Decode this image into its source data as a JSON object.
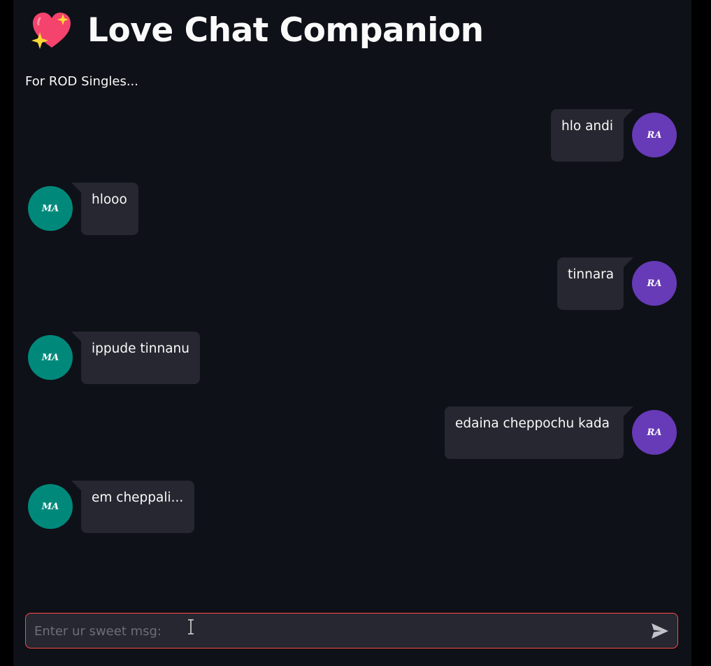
{
  "header": {
    "title": "Love Chat Companion",
    "subtitle": "For ROD Singles...",
    "title_icon": "sparkling-heart-emoji"
  },
  "colors": {
    "app_bg": "#0e1117",
    "bubble_bg": "#262730",
    "text": "#fafafa",
    "user_avatar": "#673ab7",
    "bot_avatar": "#00897b",
    "input_border": "#ff4b4b",
    "placeholder": "#6c6e78"
  },
  "avatars": {
    "user": "RA",
    "bot": "MA"
  },
  "messages": [
    {
      "sender": "user",
      "text": "hlo andi"
    },
    {
      "sender": "bot",
      "text": "hlooo"
    },
    {
      "sender": "user",
      "text": "tinnara"
    },
    {
      "sender": "bot",
      "text": "ippude tinnanu"
    },
    {
      "sender": "user",
      "text": "edaina cheppochu kada"
    },
    {
      "sender": "bot",
      "text": "em cheppali..."
    }
  ],
  "input": {
    "placeholder": "Enter ur sweet msg:",
    "value": ""
  },
  "send_icon": "send-arrow-icon"
}
